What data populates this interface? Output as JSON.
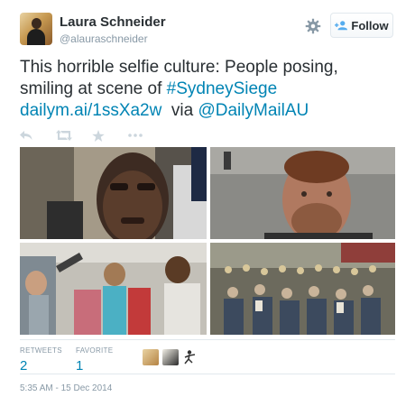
{
  "author": {
    "name": "Laura Schneider",
    "handle": "@alauraschneider"
  },
  "follow_button": {
    "label": "Follow"
  },
  "tweet": {
    "line1": "This horrible selfie culture: People posing,",
    "line2_plain": "smiling at scene of ",
    "hashtag": "#SydneySiege",
    "url": "dailym.ai/1ssXa2w",
    "via": "via",
    "mention": "@DailyMailAU"
  },
  "actions": [
    {
      "icon": "reply-icon"
    },
    {
      "icon": "retweet-icon"
    },
    {
      "icon": "favorite-star-icon"
    },
    {
      "icon": "more-icon"
    }
  ],
  "photos": [
    {
      "icon": "selfie-photo-man"
    },
    {
      "icon": "selfie-photo-bearded-man"
    },
    {
      "icon": "selfie-photo-crowd-women"
    },
    {
      "icon": "crowd-photo-street"
    }
  ],
  "stats": {
    "retweets_label": "RETWEETS",
    "retweets_value": "2",
    "favorites_label": "FAVORITE",
    "favorites_value": "1"
  },
  "timestamp": "5:35 AM - 15 Dec 2014",
  "colors": {
    "link": "#0084b4",
    "text": "#292f33",
    "muted": "#8899a6",
    "border": "#e1e8ed"
  }
}
